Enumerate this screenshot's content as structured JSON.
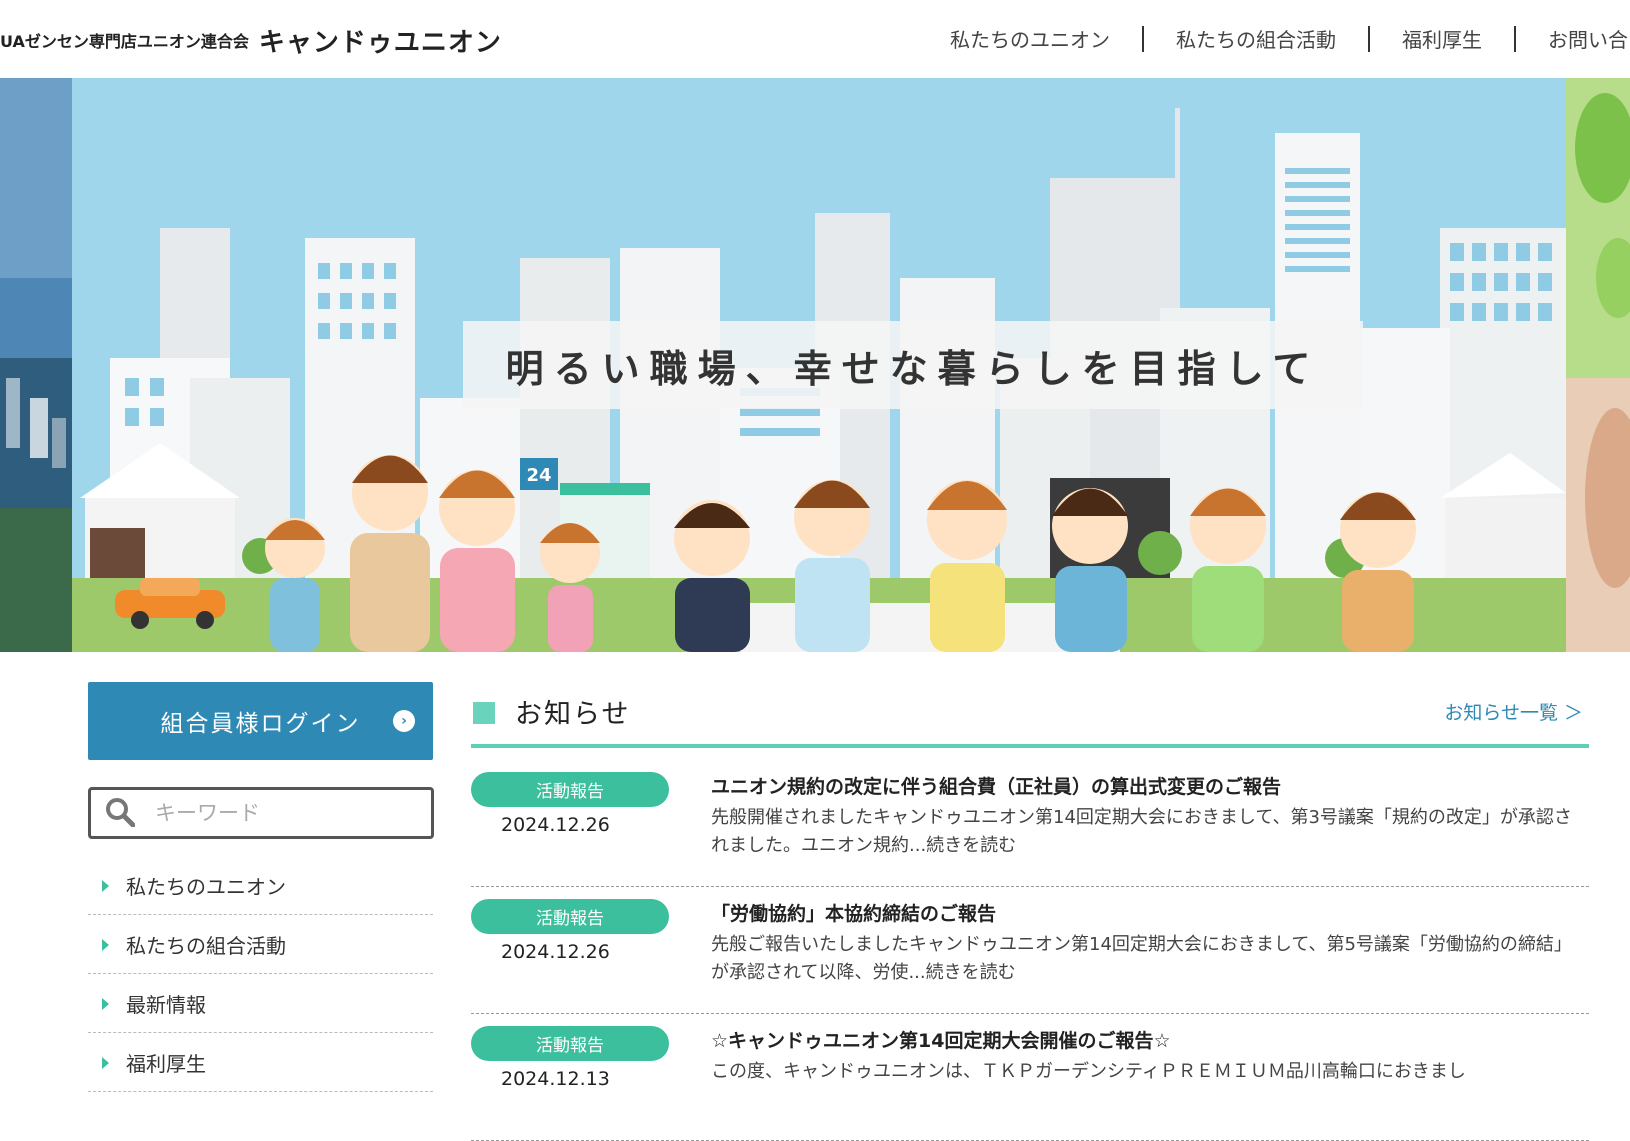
{
  "header": {
    "logo_sub": "UAゼンセン専門店ユニオン連合会",
    "logo_main": "キャンドゥユニオン",
    "nav": [
      "私たちのユニオン",
      "私たちの組合活動",
      "福利厚生",
      "お問い合"
    ]
  },
  "hero": {
    "caption": "明るい職場、幸せな暮らしを目指して",
    "sign_text": "24"
  },
  "sidebar": {
    "login_label": "組合員様ログイン",
    "search_placeholder": "キーワード",
    "items": [
      {
        "label": "私たちのユニオン"
      },
      {
        "label": "私たちの組合活動"
      },
      {
        "label": "最新情報"
      },
      {
        "label": "福利厚生"
      }
    ]
  },
  "news": {
    "title": "お知らせ",
    "more_link": "お知らせ一覧 ＞",
    "items": [
      {
        "category": "活動報告",
        "date": "2024.12.26",
        "title": "ユニオン規約の改定に伴う組合費（正社員）の算出式変更のご報告",
        "excerpt": "先般開催されましたキャンドゥユニオン第14回定期大会におきまして、第3号議案「規約の改定」が承認されました。ユニオン規約...続きを読む"
      },
      {
        "category": "活動報告",
        "date": "2024.12.26",
        "title": "「労働協約」本協約締結のご報告",
        "excerpt": "先般ご報告いたしましたキャンドゥユニオン第14回定期大会におきまして、第5号議案「労働協約の締結」が承認されて以降、労使...続きを読む"
      },
      {
        "category": "活動報告",
        "date": "2024.12.13",
        "title": "☆キャンドゥユニオン第14回定期大会開催のご報告☆",
        "excerpt": "この度、キャンドゥユニオンは、ＴＫＰガーデンシティＰＲＥＭＩＵＭ品川高輪口におきまし"
      }
    ]
  },
  "colors": {
    "accent_teal": "#3cbf9c",
    "login_blue": "#2e8ab4",
    "sky": "#9fd6eb"
  }
}
